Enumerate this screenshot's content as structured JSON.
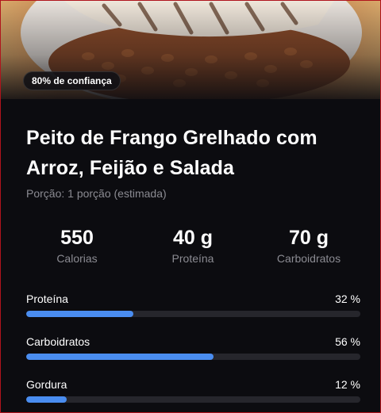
{
  "badge": {
    "confidence_label": "80% de confiança"
  },
  "food": {
    "title": "Peito de Frango Grelhado com Arroz, Feijão e Salada",
    "portion": "Porção: 1 porção (estimada)"
  },
  "stats": [
    {
      "value": "550",
      "label": "Calorias"
    },
    {
      "value": "40 g",
      "label": "Proteína"
    },
    {
      "value": "70 g",
      "label": "Carboidratos"
    }
  ],
  "macros": [
    {
      "name": "Proteína",
      "percent_label": "32 %",
      "percent": 32
    },
    {
      "name": "Carboidratos",
      "percent_label": "56 %",
      "percent": 56
    },
    {
      "name": "Gordura",
      "percent_label": "12 %",
      "percent": 12
    }
  ],
  "colors": {
    "accent": "#4a8df0",
    "track": "#26262c",
    "muted_text": "#8b8b92",
    "background": "#0c0c10"
  }
}
